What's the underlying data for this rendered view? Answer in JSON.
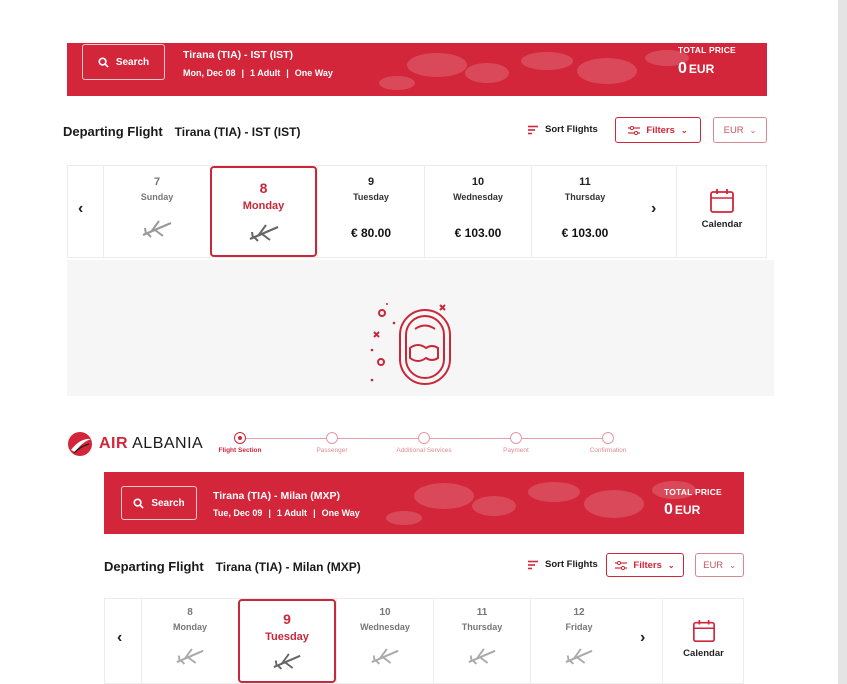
{
  "colors": {
    "brand_red": "#d3263a",
    "active_border": "#c9283a"
  },
  "top": {
    "banner": {
      "search_label": "Search",
      "route": "Tirana (TIA) - IST (IST)",
      "date": "Mon, Dec 08",
      "passengers": "1 Adult",
      "trip_type": "One Way",
      "total_label": "TOTAL PRICE",
      "total_amount": "0",
      "total_currency": "EUR"
    },
    "heading": {
      "title": "Departing Flight",
      "route": "Tirana (TIA) - IST (IST)",
      "sort_label": "Sort Flights",
      "filters_label": "Filters",
      "currency": "EUR"
    },
    "days": [
      {
        "num": "7",
        "name": "Sunday",
        "price": "",
        "state": "muted"
      },
      {
        "num": "8",
        "name": "Monday",
        "price": "",
        "state": "active"
      },
      {
        "num": "9",
        "name": "Tuesday",
        "price": "€ 80.00",
        "state": "price"
      },
      {
        "num": "10",
        "name": "Wednesday",
        "price": "€ 103.00",
        "state": "price"
      },
      {
        "num": "11",
        "name": "Thursday",
        "price": "€ 103.00",
        "state": "price"
      }
    ],
    "calendar_label": "Calendar"
  },
  "brand": {
    "air": "AIR",
    "albania": "ALBANIA"
  },
  "steps": [
    {
      "label": "Flight Section",
      "active": true
    },
    {
      "label": "Passenger",
      "active": false
    },
    {
      "label": "Additional Services",
      "active": false
    },
    {
      "label": "Payment",
      "active": false
    },
    {
      "label": "Confirmation",
      "active": false
    }
  ],
  "bottom": {
    "banner": {
      "search_label": "Search",
      "route": "Tirana (TIA) - Milan (MXP)",
      "date": "Tue, Dec 09",
      "passengers": "1 Adult",
      "trip_type": "One Way",
      "total_label": "TOTAL PRICE",
      "total_amount": "0",
      "total_currency": "EUR"
    },
    "heading": {
      "title": "Departing Flight",
      "route": "Tirana (TIA) - Milan (MXP)",
      "sort_label": "Sort Flights",
      "filters_label": "Filters",
      "currency": "EUR"
    },
    "days": [
      {
        "num": "8",
        "name": "Monday",
        "price": "",
        "state": "muted"
      },
      {
        "num": "9",
        "name": "Tuesday",
        "price": "",
        "state": "active"
      },
      {
        "num": "10",
        "name": "Wednesday",
        "price": "",
        "state": "muted"
      },
      {
        "num": "11",
        "name": "Thursday",
        "price": "",
        "state": "muted"
      },
      {
        "num": "12",
        "name": "Friday",
        "price": "",
        "state": "muted"
      }
    ],
    "calendar_label": "Calendar"
  }
}
